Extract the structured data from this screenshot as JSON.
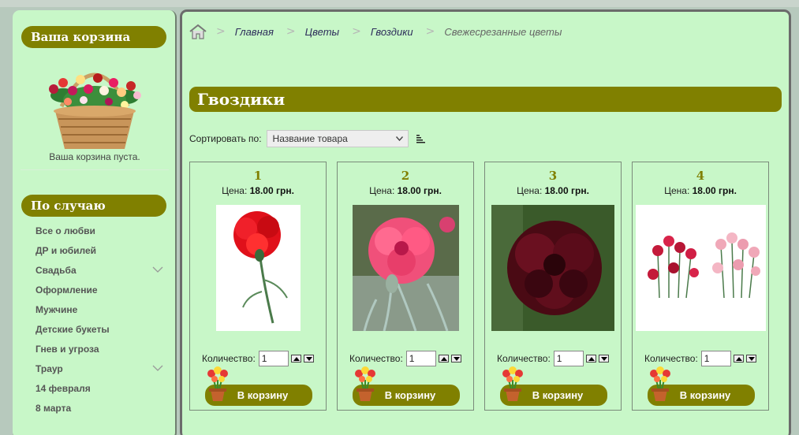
{
  "sidebar": {
    "cart_title": "Ваша корзина",
    "cart_status": "Ваша корзина пуста.",
    "occasion_title": "По случаю",
    "menu": [
      {
        "label": "Все о любви",
        "has_sub": false
      },
      {
        "label": "ДР и юбилей",
        "has_sub": false
      },
      {
        "label": "Свадьба",
        "has_sub": true
      },
      {
        "label": "Оформление",
        "has_sub": false
      },
      {
        "label": "Мужчине",
        "has_sub": false
      },
      {
        "label": "Детские букеты",
        "has_sub": false
      },
      {
        "label": "Гнев и угроза",
        "has_sub": false
      },
      {
        "label": "Траур",
        "has_sub": true
      },
      {
        "label": "14 февраля",
        "has_sub": false
      },
      {
        "label": "8 марта",
        "has_sub": false
      }
    ]
  },
  "breadcrumb": {
    "home_icon": "home-icon",
    "items": [
      "Главная",
      "Цветы",
      "Гвоздики"
    ],
    "current": "Свежесрезанные цветы"
  },
  "category": {
    "title": "Гвоздики"
  },
  "sort": {
    "label": "Сортировать по:",
    "selected": "Название товара"
  },
  "products": [
    {
      "name": "1",
      "price_label": "Цена:",
      "price": "18.00 грн.",
      "qty_label": "Количество:",
      "qty": "1",
      "button": "В корзину",
      "flower": "red-carnation"
    },
    {
      "name": "2",
      "price_label": "Цена:",
      "price": "18.00 грн.",
      "qty_label": "Количество:",
      "qty": "1",
      "button": "В корзину",
      "flower": "pink-carnation"
    },
    {
      "name": "3",
      "price_label": "Цена:",
      "price": "18.00 грн.",
      "qty_label": "Количество:",
      "qty": "1",
      "button": "В корзину",
      "flower": "dark-carnation"
    },
    {
      "name": "4",
      "price_label": "Цена:",
      "price": "18.00 грн.",
      "qty_label": "Количество:",
      "qty": "1",
      "button": "В корзину",
      "flower": "spray-carnations"
    }
  ],
  "colors": {
    "panel_bg": "#c8f7c8",
    "accent": "#808000",
    "page_bg": "#b7c9bd"
  }
}
